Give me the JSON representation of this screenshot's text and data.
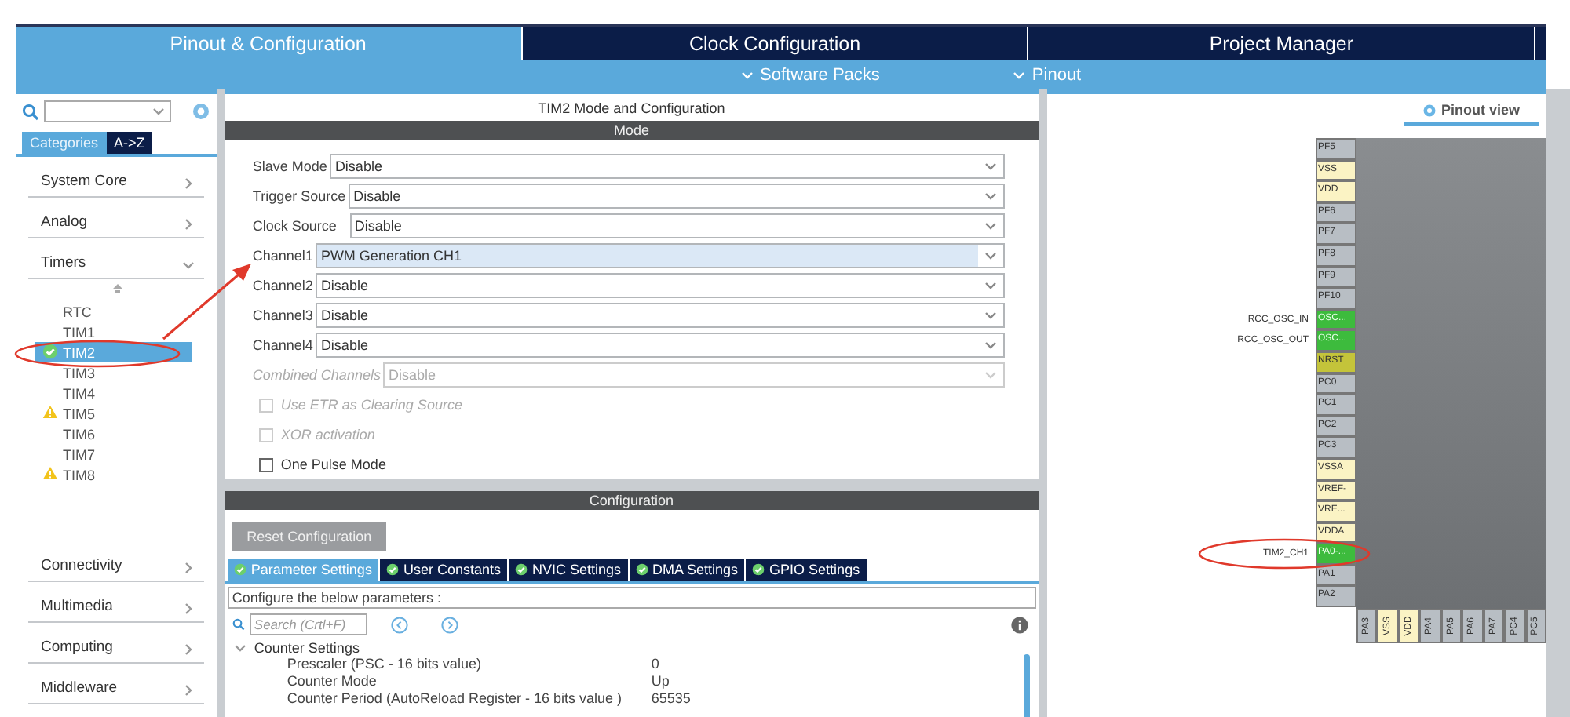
{
  "top_tabs": [
    {
      "label": "Pinout & Configuration",
      "selected": true
    },
    {
      "label": "Clock Configuration",
      "selected": false
    },
    {
      "label": "Project Manager",
      "selected": false
    }
  ],
  "sub_menu": [
    "Software Packs",
    "Pinout"
  ],
  "sidebar": {
    "view_tabs": [
      {
        "label": "Categories",
        "selected": true
      },
      {
        "label": "A->Z",
        "selected": false
      }
    ],
    "categories": [
      {
        "label": "System Core",
        "expanded": false
      },
      {
        "label": "Analog",
        "expanded": false
      },
      {
        "label": "Timers",
        "expanded": true,
        "children": [
          {
            "label": "RTC",
            "selected": false,
            "configured": false,
            "warning": false
          },
          {
            "label": "TIM1",
            "selected": false,
            "configured": false,
            "warning": false
          },
          {
            "label": "TIM2",
            "selected": true,
            "configured": true,
            "warning": false
          },
          {
            "label": "TIM3",
            "selected": false,
            "configured": false,
            "warning": false
          },
          {
            "label": "TIM4",
            "selected": false,
            "configured": false,
            "warning": false
          },
          {
            "label": "TIM5",
            "selected": false,
            "configured": false,
            "warning": true
          },
          {
            "label": "TIM6",
            "selected": false,
            "configured": false,
            "warning": false
          },
          {
            "label": "TIM7",
            "selected": false,
            "configured": false,
            "warning": false
          },
          {
            "label": "TIM8",
            "selected": false,
            "configured": false,
            "warning": true
          }
        ]
      },
      {
        "label": "Connectivity",
        "expanded": false
      },
      {
        "label": "Multimedia",
        "expanded": false
      },
      {
        "label": "Computing",
        "expanded": false
      },
      {
        "label": "Middleware",
        "expanded": false
      }
    ]
  },
  "mode_panel": {
    "title": "TIM2 Mode and Configuration",
    "header": "Mode",
    "fields": [
      {
        "label": "Slave Mode",
        "value": "Disable",
        "selected": false,
        "disabled": false
      },
      {
        "label": "Trigger Source",
        "value": "Disable",
        "selected": false,
        "disabled": false
      },
      {
        "label": "Clock Source",
        "value": "Disable",
        "selected": false,
        "disabled": false
      },
      {
        "label": "Channel1",
        "value": "PWM Generation CH1",
        "selected": true,
        "disabled": false
      },
      {
        "label": "Channel2",
        "value": "Disable",
        "selected": false,
        "disabled": false
      },
      {
        "label": "Channel3",
        "value": "Disable",
        "selected": false,
        "disabled": false
      },
      {
        "label": "Channel4",
        "value": "Disable",
        "selected": false,
        "disabled": false
      },
      {
        "label": "Combined Channels",
        "value": "Disable",
        "selected": false,
        "disabled": true
      }
    ],
    "checkboxes": [
      {
        "label": "Use ETR as Clearing Source",
        "checked": false,
        "disabled": true
      },
      {
        "label": "XOR activation",
        "checked": false,
        "disabled": true
      },
      {
        "label": "One Pulse Mode",
        "checked": false,
        "disabled": false
      }
    ]
  },
  "config_panel": {
    "header": "Configuration",
    "reset_button": "Reset Configuration",
    "tabs": [
      {
        "label": "Parameter Settings",
        "selected": true
      },
      {
        "label": "User Constants",
        "selected": false
      },
      {
        "label": "NVIC Settings",
        "selected": false
      },
      {
        "label": "DMA Settings",
        "selected": false
      },
      {
        "label": "GPIO Settings",
        "selected": false
      }
    ],
    "description": "Configure the below parameters :",
    "search": {
      "placeholder": "Search (Crtl+F)"
    },
    "group": {
      "label": "Counter Settings",
      "expanded": true,
      "parameters": [
        {
          "name": "Prescaler (PSC - 16 bits value)",
          "value": "0"
        },
        {
          "name": "Counter Mode",
          "value": "Up"
        },
        {
          "name": "Counter Period (AutoReload Register - 16 bits value )",
          "value": "65535"
        }
      ]
    }
  },
  "pinout": {
    "view_tab": "Pinout view",
    "left_pins": [
      {
        "name": "PF5",
        "kind": "io"
      },
      {
        "name": "VSS",
        "kind": "power"
      },
      {
        "name": "VDD",
        "kind": "power"
      },
      {
        "name": "PF6",
        "kind": "io"
      },
      {
        "name": "PF7",
        "kind": "io"
      },
      {
        "name": "PF8",
        "kind": "io"
      },
      {
        "name": "PF9",
        "kind": "io"
      },
      {
        "name": "PF10",
        "kind": "io"
      },
      {
        "name": "OSC...",
        "kind": "assigned",
        "signal": "RCC_OSC_IN"
      },
      {
        "name": "OSC...",
        "kind": "assigned",
        "signal": "RCC_OSC_OUT"
      },
      {
        "name": "NRST",
        "kind": "reset"
      },
      {
        "name": "PC0",
        "kind": "io"
      },
      {
        "name": "PC1",
        "kind": "io"
      },
      {
        "name": "PC2",
        "kind": "io"
      },
      {
        "name": "PC3",
        "kind": "io"
      },
      {
        "name": "VSSA",
        "kind": "power"
      },
      {
        "name": "VREF-",
        "kind": "power"
      },
      {
        "name": "VRE...",
        "kind": "power"
      },
      {
        "name": "VDDA",
        "kind": "power"
      },
      {
        "name": "PA0-...",
        "kind": "assigned",
        "signal": "TIM2_CH1"
      },
      {
        "name": "PA1",
        "kind": "io"
      },
      {
        "name": "PA2",
        "kind": "io"
      }
    ],
    "bottom_pins": [
      {
        "name": "PA3",
        "kind": "io"
      },
      {
        "name": "VSS",
        "kind": "power"
      },
      {
        "name": "VDD",
        "kind": "power"
      },
      {
        "name": "PA4",
        "kind": "io"
      },
      {
        "name": "PA5",
        "kind": "io"
      },
      {
        "name": "PA6",
        "kind": "io"
      },
      {
        "name": "PA7",
        "kind": "io"
      },
      {
        "name": "PC4",
        "kind": "io"
      },
      {
        "name": "PC5",
        "kind": "io"
      }
    ]
  }
}
